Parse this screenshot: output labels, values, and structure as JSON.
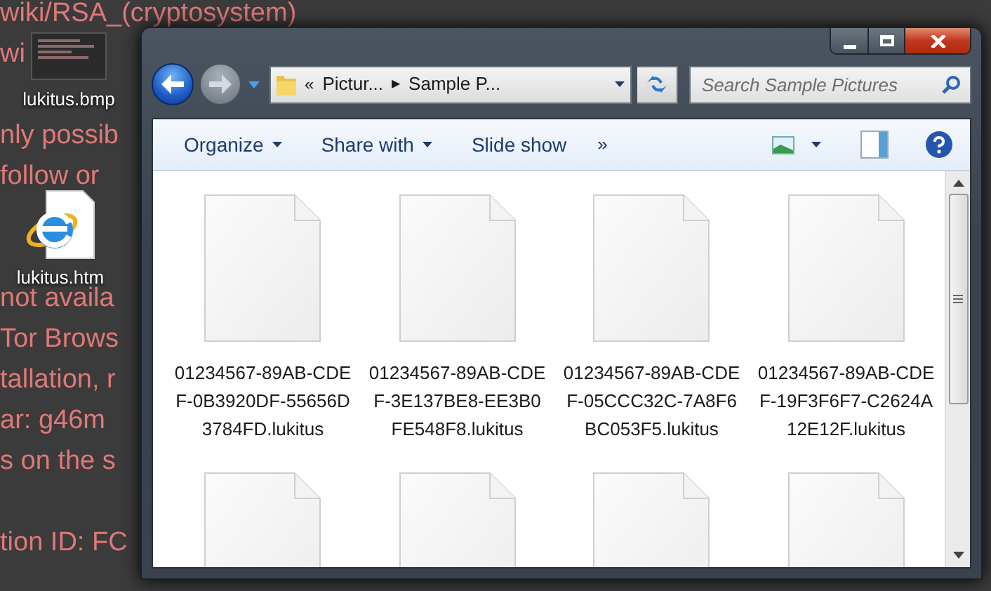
{
  "wallpaper_text": [
    "wiki/RSA_(cryptosystem)",
    "wi",
    "nly possib",
    "follow or",
    "not availa",
    "Tor Brows",
    "tallation, r",
    "ar: g46m",
    "s on the s",
    "tion ID: FC"
  ],
  "desktop_icons": [
    {
      "kind": "bitmap",
      "label": "lukitus.bmp"
    },
    {
      "kind": "web",
      "label": "lukitus.htm"
    }
  ],
  "window": {
    "address": {
      "overflow": "«",
      "crumbs": [
        "Pictur...",
        "Sample P..."
      ],
      "separator": "▶"
    },
    "search": {
      "placeholder": "Search Sample Pictures"
    },
    "toolbar": [
      {
        "label": "Organize",
        "dropdown": true
      },
      {
        "label": "Share with",
        "dropdown": true
      },
      {
        "label": "Slide show",
        "dropdown": false
      }
    ],
    "toolbar_more": "»",
    "files": [
      {
        "kind": "full",
        "name": "01234567-89AB-CDEF-0B3920DF-55656D3784FD.lukitus"
      },
      {
        "kind": "full",
        "name": "01234567-89AB-CDEF-3E137BE8-EE3B0FE548F8.lukitus"
      },
      {
        "kind": "full",
        "name": "01234567-89AB-CDEF-05CCC32C-7A8F6BC053F5.lukitus"
      },
      {
        "kind": "full",
        "name": "01234567-89AB-CDEF-19F3F6F7-C2624A12E12F.lukitus"
      },
      {
        "kind": "partial"
      },
      {
        "kind": "partial"
      },
      {
        "kind": "partial"
      },
      {
        "kind": "partial"
      }
    ]
  }
}
